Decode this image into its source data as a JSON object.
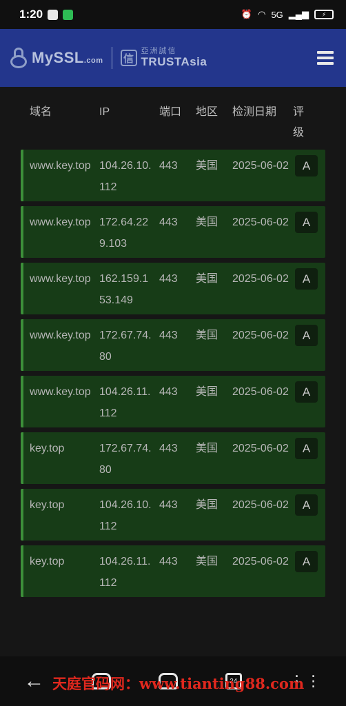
{
  "statusbar": {
    "time": "1:20",
    "network": "5G",
    "battery": "⚡"
  },
  "header": {
    "logo_main": "MySSL",
    "logo_suffix": ".com",
    "trustasia_badge": "信",
    "trustasia_cn": "亞洲誠信",
    "trustasia_en": "TRUSTAsia"
  },
  "table": {
    "headers": {
      "domain": "域名",
      "ip": "IP",
      "port": "端口",
      "region": "地区",
      "date": "检测日期",
      "grade": "评级"
    },
    "rows": [
      {
        "domain": "www.key.top",
        "ip": "104.26.10.112",
        "port": "443",
        "region": "美国",
        "date": "2025-06-02",
        "grade": "A"
      },
      {
        "domain": "www.key.top",
        "ip": "172.64.229.103",
        "port": "443",
        "region": "美国",
        "date": "2025-06-02",
        "grade": "A"
      },
      {
        "domain": "www.key.top",
        "ip": "162.159.153.149",
        "port": "443",
        "region": "美国",
        "date": "2025-06-02",
        "grade": "A"
      },
      {
        "domain": "www.key.top",
        "ip": "172.67.74.80",
        "port": "443",
        "region": "美国",
        "date": "2025-06-02",
        "grade": "A"
      },
      {
        "domain": "www.key.top",
        "ip": "104.26.11.112",
        "port": "443",
        "region": "美国",
        "date": "2025-06-02",
        "grade": "A"
      },
      {
        "domain": "key.top",
        "ip": "172.67.74.80",
        "port": "443",
        "region": "美国",
        "date": "2025-06-02",
        "grade": "A"
      },
      {
        "domain": "key.top",
        "ip": "104.26.10.112",
        "port": "443",
        "region": "美国",
        "date": "2025-06-02",
        "grade": "A"
      },
      {
        "domain": "key.top",
        "ip": "104.26.11.112",
        "port": "443",
        "region": "美国",
        "date": "2025-06-02",
        "grade": "A"
      }
    ]
  },
  "navbar": {
    "back": "←",
    "recent": "24",
    "more": "⋮⋮"
  },
  "watermark": "天庭官码网：www.tianting88.com",
  "colors": {
    "header_bg": "#23368c",
    "row_bg": "#173c17",
    "row_accent": "#3d8f3a",
    "page_bg": "#161616"
  }
}
